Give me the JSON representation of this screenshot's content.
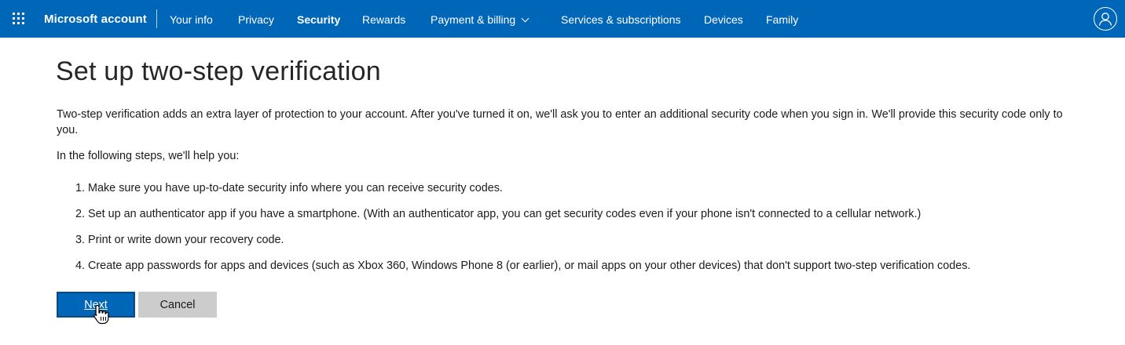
{
  "header": {
    "app_launcher_icon": "waffle-grid-icon",
    "brand": "Microsoft account",
    "nav": [
      {
        "label": "Your info",
        "active": false
      },
      {
        "label": "Privacy",
        "active": false
      },
      {
        "label": "Security",
        "active": true
      },
      {
        "label": "Rewards",
        "active": false
      },
      {
        "label": "Payment & billing",
        "active": false,
        "has_dropdown": true
      },
      {
        "label": "Services & subscriptions",
        "active": false
      },
      {
        "label": "Devices",
        "active": false
      },
      {
        "label": "Family",
        "active": false
      }
    ],
    "account_icon": "person-circle-icon",
    "bar_color": "#0067b8"
  },
  "main": {
    "title": "Set up two-step verification",
    "intro": "Two-step verification adds an extra layer of protection to your account. After you've turned it on, we'll ask you to enter an additional security code when you sign in. We'll provide this security code only to you.",
    "lead": "In the following steps, we'll help you:",
    "steps": [
      "1. Make sure you have up-to-date security info where you can receive security codes.",
      "2. Set up an authenticator app if you have a smartphone. (With an authenticator app, you can get security codes even if your phone isn't connected to a cellular network.)",
      "3. Print or write down your recovery code.",
      "4. Create app passwords for apps and devices (such as Xbox 360, Windows Phone 8 (or earlier), or mail apps on your other devices) that don't support two-step verification codes."
    ],
    "buttons": {
      "next": "Next",
      "cancel": "Cancel"
    },
    "primary_color": "#0067b8"
  }
}
